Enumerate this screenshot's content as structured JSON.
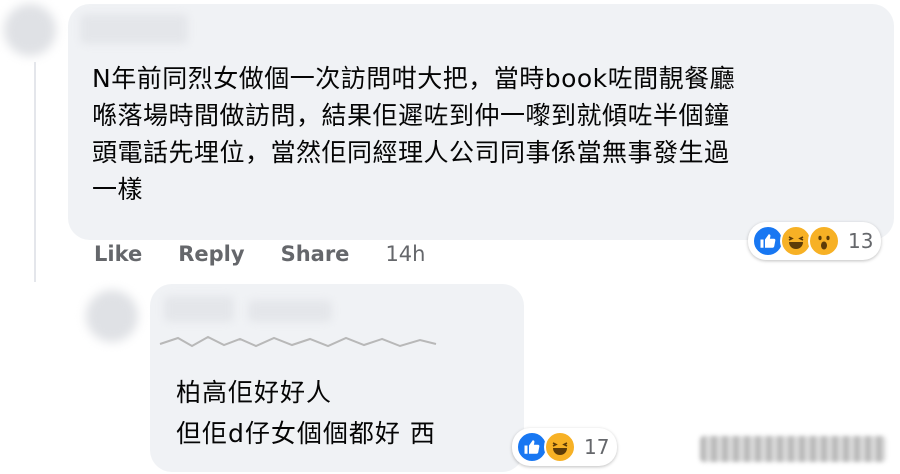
{
  "comment_1": {
    "text": "N年前同烈女做個一次訪問咁大把，當時book咗間靚餐廳\n喺落場時間做訪問，結果佢遲咗到仲一嚟到就傾咗半個鐘\n頭電話先埋位，當然佢同經理人公司同事係當無事發生過\n一樣",
    "actions": {
      "like": "Like",
      "reply": "Reply",
      "share": "Share",
      "time": "14h"
    },
    "reactions": {
      "icons": [
        "like-icon",
        "haha-icon",
        "wow-icon"
      ],
      "count": "13"
    }
  },
  "comment_2": {
    "text": "柏高佢好好人\n但佢d仔女個個都好    西",
    "reactions": {
      "icons": [
        "like-icon",
        "haha-icon"
      ],
      "count": "17"
    }
  },
  "colors": {
    "bubble": "#f0f2f5",
    "like_blue": "#1877f2",
    "reaction_yellow": "#f7b125",
    "muted_text": "#65676b"
  }
}
